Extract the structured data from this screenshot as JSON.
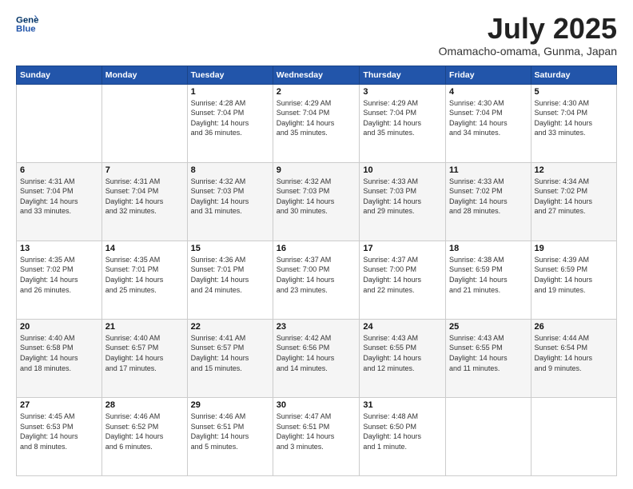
{
  "logo": {
    "line1": "General",
    "line2": "Blue"
  },
  "title": "July 2025",
  "subtitle": "Omamacho-omama, Gunma, Japan",
  "days": [
    "Sunday",
    "Monday",
    "Tuesday",
    "Wednesday",
    "Thursday",
    "Friday",
    "Saturday"
  ],
  "weeks": [
    [
      {
        "day": "",
        "info": ""
      },
      {
        "day": "",
        "info": ""
      },
      {
        "day": "1",
        "info": "Sunrise: 4:28 AM\nSunset: 7:04 PM\nDaylight: 14 hours\nand 36 minutes."
      },
      {
        "day": "2",
        "info": "Sunrise: 4:29 AM\nSunset: 7:04 PM\nDaylight: 14 hours\nand 35 minutes."
      },
      {
        "day": "3",
        "info": "Sunrise: 4:29 AM\nSunset: 7:04 PM\nDaylight: 14 hours\nand 35 minutes."
      },
      {
        "day": "4",
        "info": "Sunrise: 4:30 AM\nSunset: 7:04 PM\nDaylight: 14 hours\nand 34 minutes."
      },
      {
        "day": "5",
        "info": "Sunrise: 4:30 AM\nSunset: 7:04 PM\nDaylight: 14 hours\nand 33 minutes."
      }
    ],
    [
      {
        "day": "6",
        "info": "Sunrise: 4:31 AM\nSunset: 7:04 PM\nDaylight: 14 hours\nand 33 minutes."
      },
      {
        "day": "7",
        "info": "Sunrise: 4:31 AM\nSunset: 7:04 PM\nDaylight: 14 hours\nand 32 minutes."
      },
      {
        "day": "8",
        "info": "Sunrise: 4:32 AM\nSunset: 7:03 PM\nDaylight: 14 hours\nand 31 minutes."
      },
      {
        "day": "9",
        "info": "Sunrise: 4:32 AM\nSunset: 7:03 PM\nDaylight: 14 hours\nand 30 minutes."
      },
      {
        "day": "10",
        "info": "Sunrise: 4:33 AM\nSunset: 7:03 PM\nDaylight: 14 hours\nand 29 minutes."
      },
      {
        "day": "11",
        "info": "Sunrise: 4:33 AM\nSunset: 7:02 PM\nDaylight: 14 hours\nand 28 minutes."
      },
      {
        "day": "12",
        "info": "Sunrise: 4:34 AM\nSunset: 7:02 PM\nDaylight: 14 hours\nand 27 minutes."
      }
    ],
    [
      {
        "day": "13",
        "info": "Sunrise: 4:35 AM\nSunset: 7:02 PM\nDaylight: 14 hours\nand 26 minutes."
      },
      {
        "day": "14",
        "info": "Sunrise: 4:35 AM\nSunset: 7:01 PM\nDaylight: 14 hours\nand 25 minutes."
      },
      {
        "day": "15",
        "info": "Sunrise: 4:36 AM\nSunset: 7:01 PM\nDaylight: 14 hours\nand 24 minutes."
      },
      {
        "day": "16",
        "info": "Sunrise: 4:37 AM\nSunset: 7:00 PM\nDaylight: 14 hours\nand 23 minutes."
      },
      {
        "day": "17",
        "info": "Sunrise: 4:37 AM\nSunset: 7:00 PM\nDaylight: 14 hours\nand 22 minutes."
      },
      {
        "day": "18",
        "info": "Sunrise: 4:38 AM\nSunset: 6:59 PM\nDaylight: 14 hours\nand 21 minutes."
      },
      {
        "day": "19",
        "info": "Sunrise: 4:39 AM\nSunset: 6:59 PM\nDaylight: 14 hours\nand 19 minutes."
      }
    ],
    [
      {
        "day": "20",
        "info": "Sunrise: 4:40 AM\nSunset: 6:58 PM\nDaylight: 14 hours\nand 18 minutes."
      },
      {
        "day": "21",
        "info": "Sunrise: 4:40 AM\nSunset: 6:57 PM\nDaylight: 14 hours\nand 17 minutes."
      },
      {
        "day": "22",
        "info": "Sunrise: 4:41 AM\nSunset: 6:57 PM\nDaylight: 14 hours\nand 15 minutes."
      },
      {
        "day": "23",
        "info": "Sunrise: 4:42 AM\nSunset: 6:56 PM\nDaylight: 14 hours\nand 14 minutes."
      },
      {
        "day": "24",
        "info": "Sunrise: 4:43 AM\nSunset: 6:55 PM\nDaylight: 14 hours\nand 12 minutes."
      },
      {
        "day": "25",
        "info": "Sunrise: 4:43 AM\nSunset: 6:55 PM\nDaylight: 14 hours\nand 11 minutes."
      },
      {
        "day": "26",
        "info": "Sunrise: 4:44 AM\nSunset: 6:54 PM\nDaylight: 14 hours\nand 9 minutes."
      }
    ],
    [
      {
        "day": "27",
        "info": "Sunrise: 4:45 AM\nSunset: 6:53 PM\nDaylight: 14 hours\nand 8 minutes."
      },
      {
        "day": "28",
        "info": "Sunrise: 4:46 AM\nSunset: 6:52 PM\nDaylight: 14 hours\nand 6 minutes."
      },
      {
        "day": "29",
        "info": "Sunrise: 4:46 AM\nSunset: 6:51 PM\nDaylight: 14 hours\nand 5 minutes."
      },
      {
        "day": "30",
        "info": "Sunrise: 4:47 AM\nSunset: 6:51 PM\nDaylight: 14 hours\nand 3 minutes."
      },
      {
        "day": "31",
        "info": "Sunrise: 4:48 AM\nSunset: 6:50 PM\nDaylight: 14 hours\nand 1 minute."
      },
      {
        "day": "",
        "info": ""
      },
      {
        "day": "",
        "info": ""
      }
    ]
  ]
}
